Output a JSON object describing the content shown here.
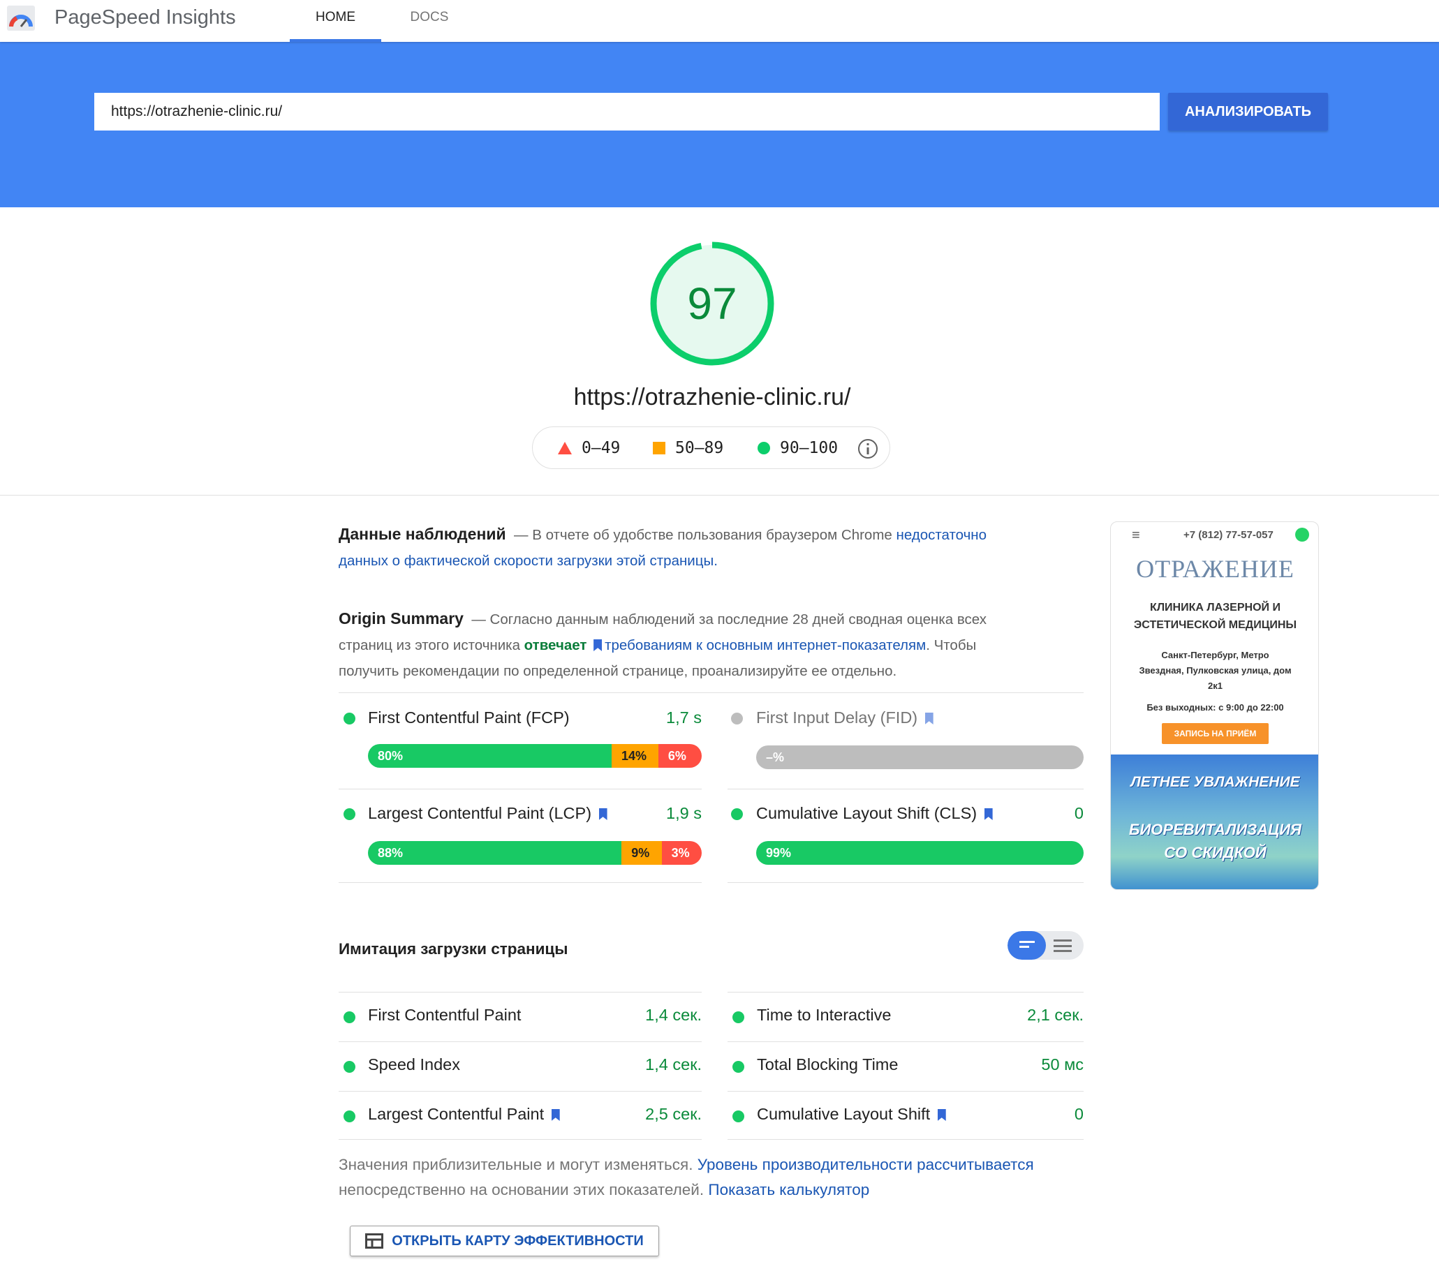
{
  "header": {
    "app_title": "PageSpeed Insights",
    "tabs": [
      "HOME",
      "DOCS"
    ]
  },
  "search": {
    "url_value": "https://otrazhenie-clinic.ru/",
    "analyze_label": "АНАЛИЗИРОВАТЬ"
  },
  "score": {
    "value": "97",
    "url": "https://otrazhenie-clinic.ru/",
    "color": "#0cce6b"
  },
  "legend": {
    "poor": "0–49",
    "average": "50–89",
    "good": "90–100",
    "colors": {
      "poor": "#ff4e42",
      "average": "#ffa400",
      "good": "#0cce6b"
    }
  },
  "field": {
    "title": "Данные наблюдений",
    "text": "— В отчете об удобстве пользования браузером Chrome ",
    "link": "недостаточно данных о фактической скорости загрузки этой страницы."
  },
  "origin": {
    "title": "Origin Summary",
    "text1": "— Согласно данным наблюдений за последние 28 дней сводная оценка всех страниц из этого источника ",
    "status": "отвечает",
    "link": "требованиям к основным интернет-показателям",
    "text2": ". Чтобы получить рекомендации по определенной странице, проанализируйте ее отдельно."
  },
  "field_metrics": [
    {
      "label": "First Contentful Paint (FCP)",
      "value": "1,7 s",
      "dist": [
        "80%",
        "14%",
        "6%"
      ],
      "fractions": [
        80,
        14,
        6
      ],
      "status": "good"
    },
    {
      "label": "First Input Delay (FID)",
      "value": "",
      "dist": [
        "–%"
      ],
      "fractions": [
        100
      ],
      "status": "none"
    },
    {
      "label": "Largest Contentful Paint (LCP)",
      "value": "1,9 s",
      "dist": [
        "88%",
        "9%",
        "3%"
      ],
      "fractions": [
        88,
        9,
        3
      ],
      "status": "good"
    },
    {
      "label": "Cumulative Layout Shift (CLS)",
      "value": "0",
      "dist": [
        "99%"
      ],
      "fractions": [
        99
      ],
      "status": "good"
    }
  ],
  "lab": {
    "title": "Имитация загрузки страницы",
    "metrics": [
      {
        "label": "First Contentful Paint",
        "value": "1,4 сек."
      },
      {
        "label": "Time to Interactive",
        "value": "2,1 сек."
      },
      {
        "label": "Speed Index",
        "value": "1,4 сек."
      },
      {
        "label": "Total Blocking Time",
        "value": "50 мс"
      },
      {
        "label": "Largest Contentful Paint",
        "value": "2,5 сек."
      },
      {
        "label": "Cumulative Layout Shift",
        "value": "0"
      }
    ],
    "note1": "Значения приблизительные и могут изменяться. ",
    "note_link1": "Уровень производительности рассчитывается",
    "note2": " непосредственно на основании этих показателей. ",
    "note_link2": "Показать калькулятор",
    "map_button": "ОТКРЫТЬ КАРТУ ЭФФЕКТИВНОСТИ"
  },
  "screenshot": {
    "phone": "+7 (812) 77-57-057",
    "logo": "ОТРАЖЕНИЕ",
    "heading": "КЛИНИКА ЛАЗЕРНОЙ И ЭСТЕТИЧЕСКОЙ МЕДИЦИНЫ",
    "address": "Санкт-Петербург, Метро Звездная, Пулковская улица, дом 2к1",
    "hours": "Без выходных: с 9:00 до 22:00",
    "cta": "ЗАПИСЬ НА ПРИЁМ",
    "banner1": "ЛЕТНЕЕ УВЛАЖНЕНИЕ",
    "banner2": "БИОРЕВИТАЛИЗАЦИЯ",
    "banner3": "СО СКИДКОЙ"
  }
}
